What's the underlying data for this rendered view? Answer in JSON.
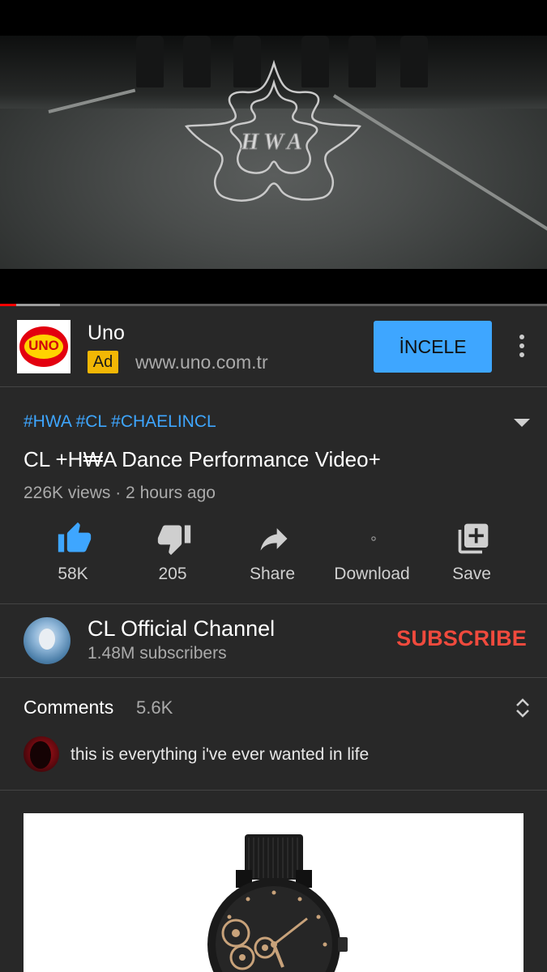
{
  "player": {
    "progress_played": 0.03,
    "progress_buffered": 0.11,
    "logo_text": "HWA"
  },
  "ad": {
    "logo_text": "UNO",
    "name": "Uno",
    "badge": "Ad",
    "url": "www.uno.com.tr",
    "cta": "İNCELE",
    "more_icon": "more-vert-icon"
  },
  "video": {
    "hashtags": "#HWA #CL #CHAELINCL",
    "title": "CL +H₩A Dance Performance Video+",
    "meta": "226K views · 2 hours ago"
  },
  "actions": [
    {
      "icon": "thumb-up-icon",
      "label": "58K",
      "color": "#3ea6ff"
    },
    {
      "icon": "thumb-down-icon",
      "label": "205",
      "color": "#cfcfcf"
    },
    {
      "icon": "share-icon",
      "label": "Share",
      "color": "#cfcfcf"
    },
    {
      "icon": "download-icon",
      "label": "Download",
      "color": "#cfcfcf"
    },
    {
      "icon": "save-icon",
      "label": "Save",
      "color": "#cfcfcf"
    }
  ],
  "channel": {
    "name": "CL Official Channel",
    "subscribers": "1.48M subscribers",
    "subscribe_label": "SUBSCRIBE",
    "subscribe_color": "#f04a3d"
  },
  "comments": {
    "title": "Comments",
    "count": "5.6K",
    "top_comment": "this is everything i've ever wanted in life"
  },
  "ad_card": {
    "image": "watch-image"
  }
}
